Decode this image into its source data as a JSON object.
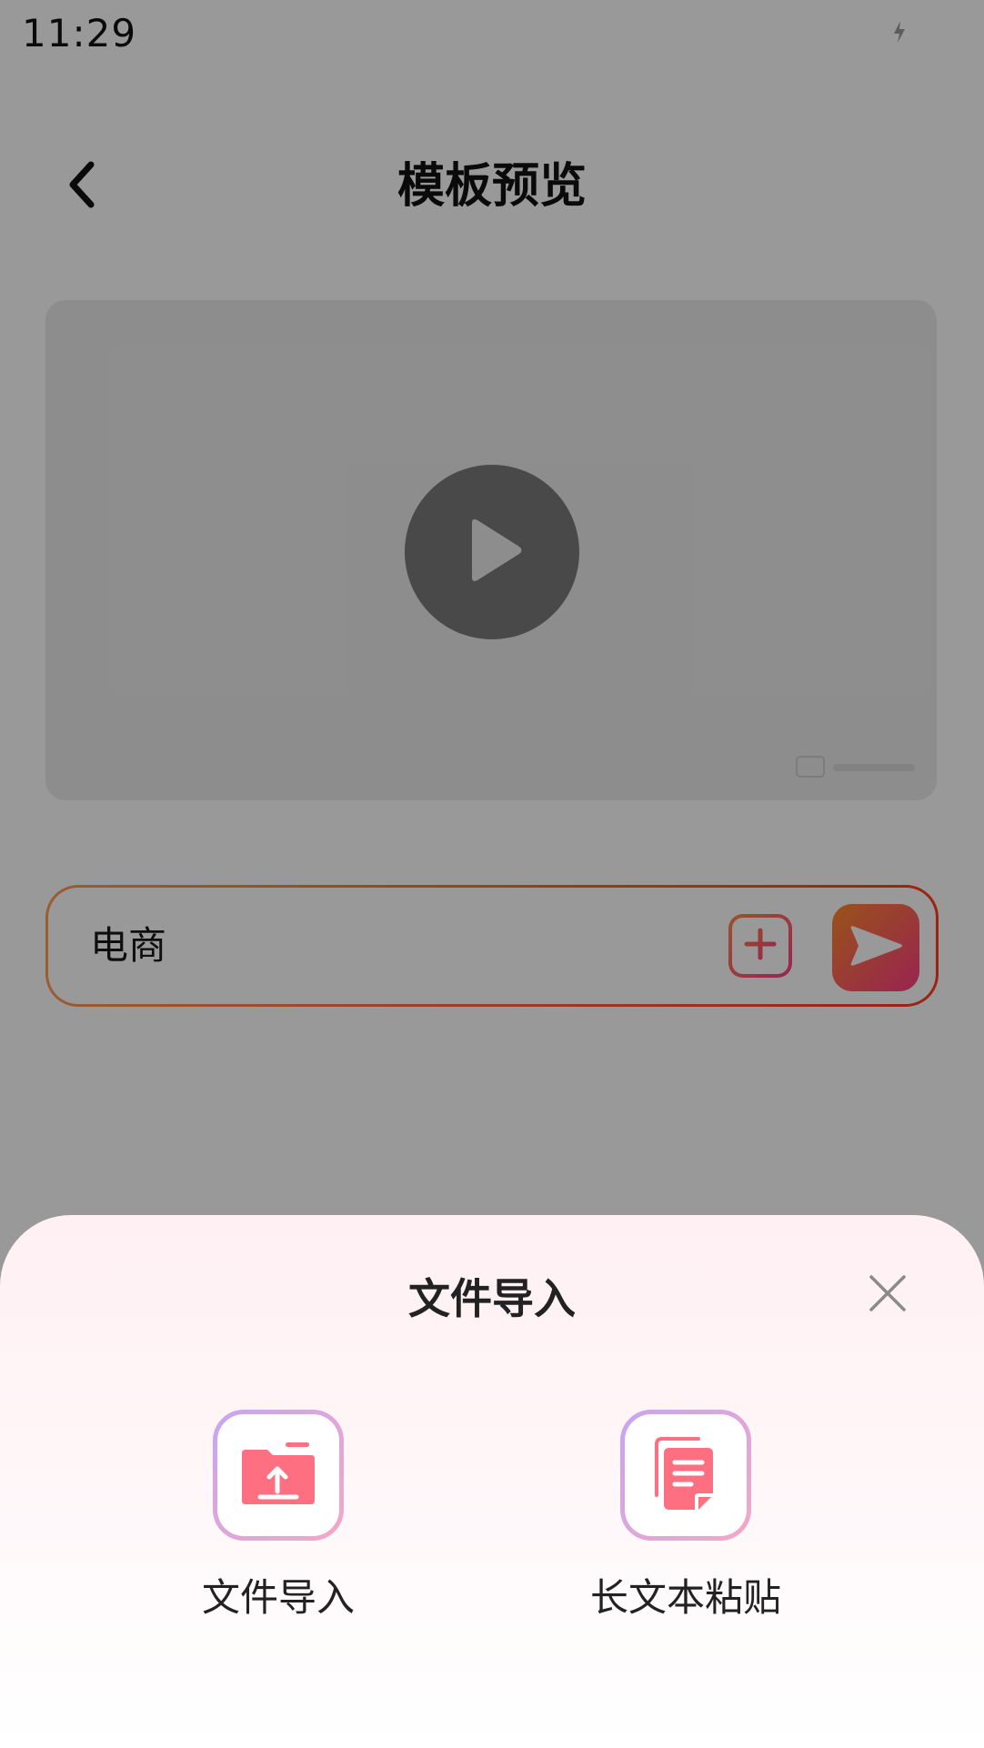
{
  "status_bar": {
    "time": "11:29",
    "icons": [
      "wifi-icon",
      "cellular-signal-icon",
      "battery-charging-icon"
    ]
  },
  "header": {
    "back_icon": "chevron-left-icon",
    "title": "模板预览"
  },
  "preview": {
    "play_icon": "play-icon"
  },
  "prompt_input": {
    "value": "电商",
    "add_icon": "plus-icon",
    "send_icon": "send-icon"
  },
  "import_sheet": {
    "title": "文件导入",
    "close_icon": "close-icon",
    "options": [
      {
        "label": "文件导入",
        "icon": "folder-upload-icon"
      },
      {
        "label": "长文本粘贴",
        "icon": "document-paste-icon"
      }
    ]
  },
  "colors": {
    "accent_gradient_start": "#ff8a2a",
    "accent_gradient_end": "#ff3c88",
    "icon_pink": "#ff6f82",
    "tile_border_start": "#c6a6f2",
    "tile_border_end": "#f5a7c4",
    "overlay": "rgba(0,0,0,0.40)"
  }
}
